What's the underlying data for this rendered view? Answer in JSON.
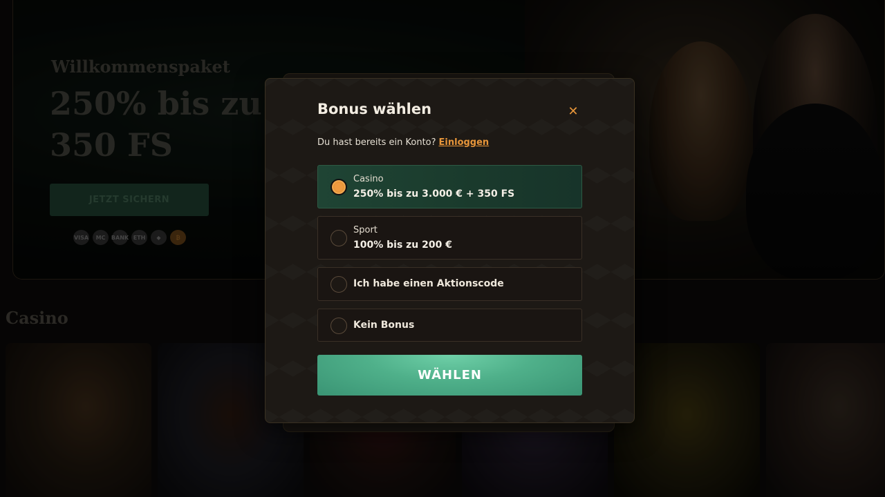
{
  "hero": {
    "kicker": "Willkommenspaket",
    "title": "250% bis zu 350 FS",
    "cta_label": "JETZT SICHERN",
    "payment_icons": [
      "visa-icon",
      "mastercard-icon",
      "bank-icon",
      "ethereum-icon",
      "diamond-icon",
      "bitcoin-icon"
    ],
    "payment_labels": [
      "VISA",
      "MC",
      "BANK",
      "ETH",
      "◆",
      "₿"
    ]
  },
  "section": {
    "casino_heading": "Casino"
  },
  "modal": {
    "title": "Bonus wählen",
    "close_icon": "close-icon",
    "login_prompt": "Du hast bereits ein Konto?",
    "login_link": "Einloggen",
    "options": [
      {
        "label": "Casino",
        "sub": "250% bis zu 3.000 € + 350 FS",
        "selected": true
      },
      {
        "label": "Sport",
        "sub": "100% bis zu 200 €",
        "selected": false
      },
      {
        "label": "Ich habe einen Aktionscode",
        "selected": false
      },
      {
        "label": "Kein Bonus",
        "selected": false
      }
    ],
    "submit_label": "WÄHLEN"
  },
  "colors": {
    "accent": "#e8963a",
    "selected_bg": "#1f4434",
    "button": "#4fb08a"
  }
}
